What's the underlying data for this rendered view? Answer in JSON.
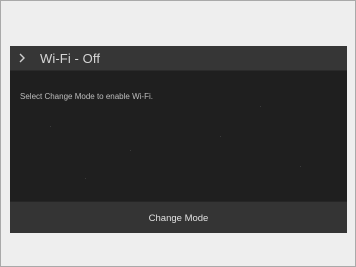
{
  "header": {
    "chevron_icon": "chevron-right-icon",
    "title": "Wi-Fi - Off"
  },
  "body": {
    "message": "Select Change Mode to enable Wi-Fi."
  },
  "footer": {
    "button_label": "Change Mode"
  },
  "colors": {
    "page_background": "#eeeeee",
    "screen_background": "#1f1f1f",
    "header_background": "#363636",
    "button_background": "#343434",
    "text_color": "#d6d6d6"
  }
}
